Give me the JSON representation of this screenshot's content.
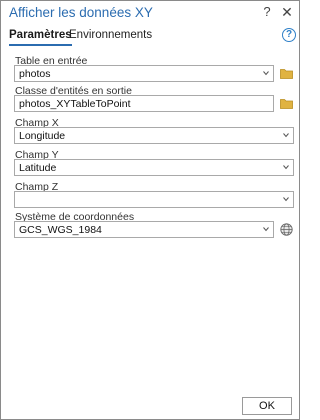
{
  "window": {
    "title": "Afficher les données XY",
    "help_symbol": "?",
    "close_symbol": "✕"
  },
  "tabs": [
    {
      "label": "Paramètres",
      "active": true
    },
    {
      "label": "Environnements",
      "active": false
    }
  ],
  "help_icon_symbol": "?",
  "fields": {
    "input_table": {
      "label": "Table en entrée",
      "value": "photos"
    },
    "output_class": {
      "label": "Classe d'entités en sortie",
      "value": "photos_XYTableToPoint"
    },
    "x_field": {
      "label": "Champ X",
      "value": "Longitude"
    },
    "y_field": {
      "label": "Champ Y",
      "value": "Latitude"
    },
    "z_field": {
      "label": "Champ Z",
      "value": ""
    },
    "coord_system": {
      "label": "Système de coordonnées",
      "value": "GCS_WGS_1984"
    }
  },
  "ok_label": "OK",
  "colors": {
    "accent": "#2b6cb0",
    "folder": "#e0b341",
    "help_icon": "#2f80c8"
  }
}
